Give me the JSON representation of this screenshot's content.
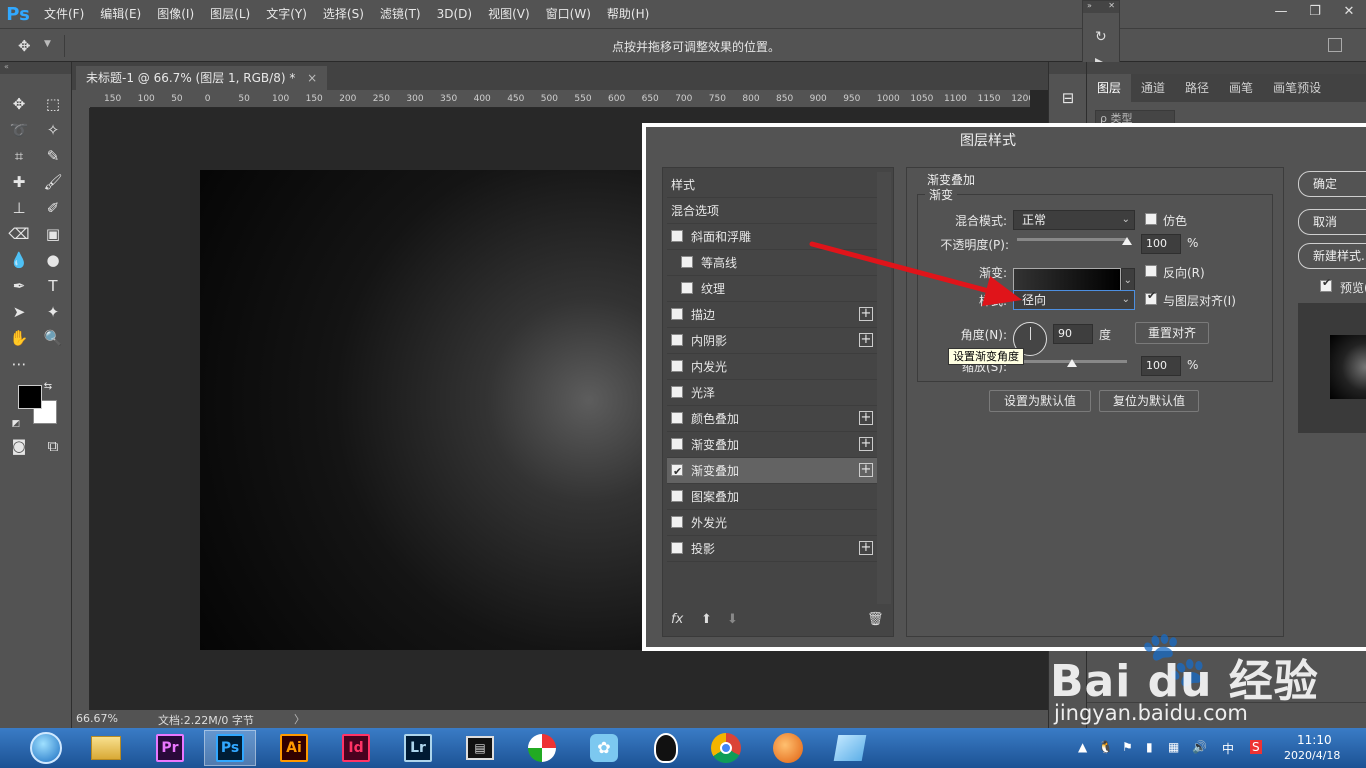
{
  "app": {
    "logo": "Ps",
    "menu": [
      "文件(F)",
      "编辑(E)",
      "图像(I)",
      "图层(L)",
      "文字(Y)",
      "选择(S)",
      "滤镜(T)",
      "3D(D)",
      "视图(V)",
      "窗口(W)",
      "帮助(H)"
    ],
    "window_controls": {
      "minimize": "—",
      "restore": "❐",
      "close": "✕"
    }
  },
  "options_bar": {
    "hint": "点按并拖移可调整效果的位置。"
  },
  "document": {
    "tab_title": "未标题-1 @ 66.7% (图层 1, RGB/8) *",
    "close": "×",
    "ruler_ticks": [
      "150",
      "100",
      "50",
      "0",
      "50",
      "100",
      "150",
      "200",
      "250",
      "300",
      "350",
      "400",
      "450",
      "500",
      "550",
      "600",
      "650",
      "700",
      "750",
      "800",
      "850",
      "900",
      "950",
      "1000",
      "1050",
      "1100",
      "1150",
      "1200"
    ]
  },
  "status": {
    "zoom": "66.67%",
    "doc_info": "文档:2.22M/0 字节",
    "arrow": "〉"
  },
  "right_panel": {
    "tabs": [
      "图层",
      "通道",
      "路径",
      "画笔",
      "画笔预设"
    ],
    "active_tab": "图层",
    "filter_placeholder": "ρ 类型"
  },
  "dialog": {
    "title": "图层样式",
    "styles": [
      {
        "label": "样式",
        "checkbox": false,
        "plus": false,
        "indent": 0
      },
      {
        "label": "混合选项",
        "checkbox": false,
        "plus": false,
        "indent": 0
      },
      {
        "label": "斜面和浮雕",
        "checkbox": true,
        "checked": false,
        "plus": false,
        "indent": 0
      },
      {
        "label": "等高线",
        "checkbox": true,
        "checked": false,
        "plus": false,
        "indent": 1
      },
      {
        "label": "纹理",
        "checkbox": true,
        "checked": false,
        "plus": false,
        "indent": 1
      },
      {
        "label": "描边",
        "checkbox": true,
        "checked": false,
        "plus": true,
        "indent": 0
      },
      {
        "label": "内阴影",
        "checkbox": true,
        "checked": false,
        "plus": true,
        "indent": 0
      },
      {
        "label": "内发光",
        "checkbox": true,
        "checked": false,
        "plus": false,
        "indent": 0
      },
      {
        "label": "光泽",
        "checkbox": true,
        "checked": false,
        "plus": false,
        "indent": 0
      },
      {
        "label": "颜色叠加",
        "checkbox": true,
        "checked": false,
        "plus": true,
        "indent": 0
      },
      {
        "label": "渐变叠加",
        "checkbox": true,
        "checked": false,
        "plus": true,
        "indent": 0
      },
      {
        "label": "渐变叠加",
        "checkbox": true,
        "checked": true,
        "plus": true,
        "indent": 0,
        "selected": true
      },
      {
        "label": "图案叠加",
        "checkbox": true,
        "checked": false,
        "plus": false,
        "indent": 0
      },
      {
        "label": "外发光",
        "checkbox": true,
        "checked": false,
        "plus": false,
        "indent": 0
      },
      {
        "label": "投影",
        "checkbox": true,
        "checked": false,
        "plus": true,
        "indent": 0
      }
    ],
    "footer": {
      "fx": "fx",
      "up": "⬆",
      "down": "⬇",
      "trash": "🗑"
    },
    "section_title": "渐变叠加",
    "group_title": "渐变",
    "blend_mode_label": "混合模式:",
    "blend_mode_value": "正常",
    "dither_label": "仿色",
    "opacity_label": "不透明度(P):",
    "opacity_value": "100",
    "opacity_fraction": 1.0,
    "percent": "%",
    "gradient_label": "渐变:",
    "reverse_label": "反向(R)",
    "style_label": "样式:",
    "style_value": "径向",
    "align_label": "与图层对齐(I)",
    "angle_label": "角度(N):",
    "angle_value": "90",
    "angle_unit": "度",
    "reset_align": "重置对齐",
    "tooltip": "设置渐变角度",
    "scale_label": "缩放(S):",
    "scale_value": "100",
    "scale_fraction": 0.5,
    "set_default": "设置为默认值",
    "reset_default": "复位为默认值",
    "ok": "确定",
    "cancel": "取消",
    "new_style": "新建样式...",
    "preview_label": "预览(V)"
  },
  "watermark": {
    "brand": "Bai du 经验",
    "url": "jingyan.baidu.com"
  },
  "taskbar": {
    "apps": [
      {
        "name": "Pr",
        "color": "#ea77ff",
        "bg": "#2a0a3a"
      },
      {
        "name": "Ps",
        "color": "#31a8ff",
        "bg": "#001e36"
      },
      {
        "name": "Ai",
        "color": "#ff9a00",
        "bg": "#330000"
      },
      {
        "name": "Id",
        "color": "#ff3366",
        "bg": "#49021f"
      },
      {
        "name": "Lr",
        "color": "#add5ec",
        "bg": "#001a33"
      }
    ],
    "time": "11:10",
    "date": "2020/4/18",
    "ime": "中"
  }
}
